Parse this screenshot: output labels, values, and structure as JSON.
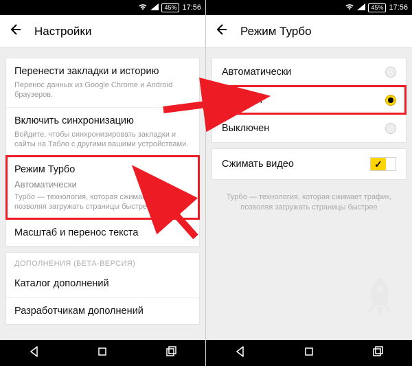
{
  "status": {
    "battery": "45%",
    "time": "17:56"
  },
  "left": {
    "header_title": "Настройки",
    "bookmarks": {
      "title": "Перенести закладки и историю",
      "sub": "Перенос данных из Google Chrome и Android браузеров."
    },
    "sync": {
      "title": "Включить синхронизацию",
      "sub": "Войдите, чтобы синхронизировать закладки и сайты на Табло с другими вашими устройствами."
    },
    "turbo": {
      "title": "Режим Турбо",
      "value": "Автоматически",
      "desc": "Турбо — технология, которая сжимает трафик, позволяя загружать страницы быстрее"
    },
    "textwrap": {
      "title": "Масштаб и перенос текста"
    },
    "addons_header": "ДОПОЛНЕНИЯ (БЕТА-ВЕРСИЯ)",
    "addons_catalog": "Каталог дополнений",
    "addons_dev": "Разработчикам дополнений"
  },
  "right": {
    "header_title": "Режим Турбо",
    "opt_auto": "Автоматически",
    "opt_on": "Включен",
    "opt_off": "Выключен",
    "compress_video": "Сжимать видео",
    "info": "Турбо — технология, которая сжимает трафик, позволяя загружать страницы быстрее"
  }
}
